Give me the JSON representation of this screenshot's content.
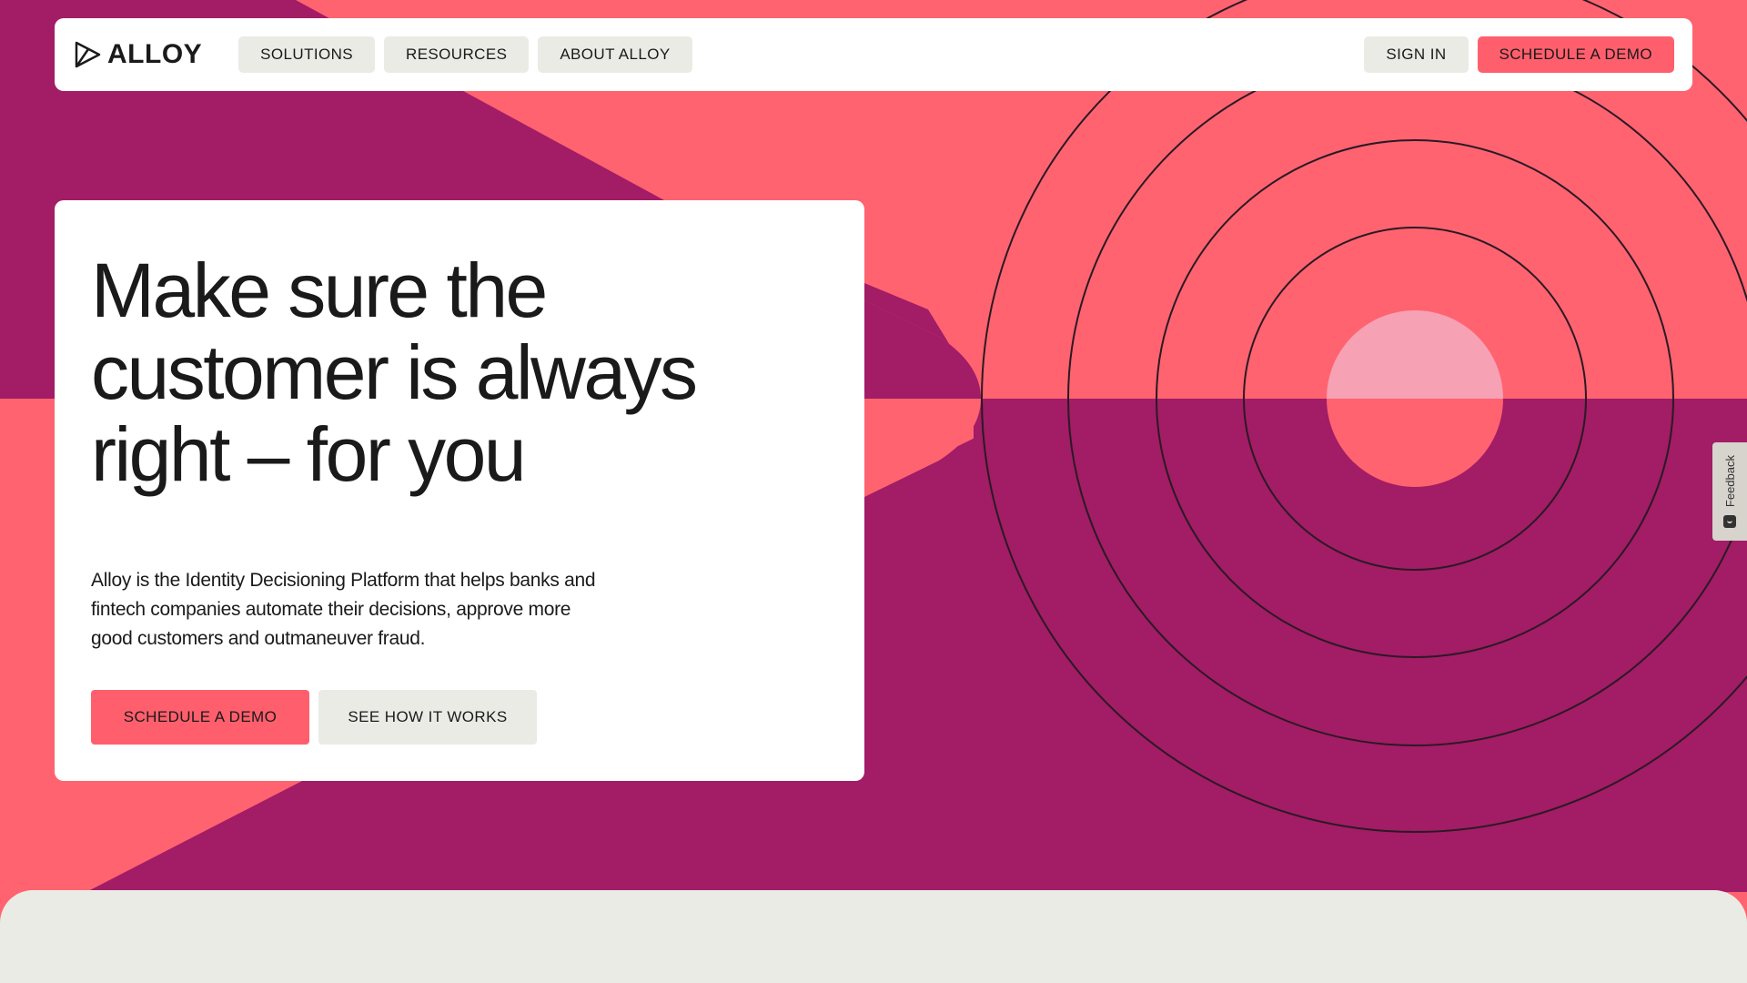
{
  "brand": {
    "name": "ALLOY",
    "colors": {
      "coral": "#FF6370",
      "magenta": "#A21C66",
      "pink": "#F7A1B5",
      "button_primary": "#FF5F6D",
      "button_secondary": "#EBEBE6",
      "text": "#1a1a1a"
    }
  },
  "nav": {
    "logo_icon": "alloy-logo-icon",
    "items": [
      {
        "label": "SOLUTIONS"
      },
      {
        "label": "RESOURCES"
      },
      {
        "label": "ABOUT ALLOY"
      }
    ],
    "sign_in_label": "SIGN IN",
    "demo_label": "SCHEDULE A DEMO"
  },
  "hero": {
    "title": "Make sure the customer is always right – for you",
    "description": "Alloy is the Identity Decisioning Platform that helps banks and fintech companies automate their decisions, approve more good customers and outmaneuver fraud.",
    "primary_cta": "SCHEDULE A DEMO",
    "secondary_cta": "SEE HOW IT WORKS"
  },
  "feedback": {
    "label": "Feedback",
    "icon": "feedback-icon"
  }
}
